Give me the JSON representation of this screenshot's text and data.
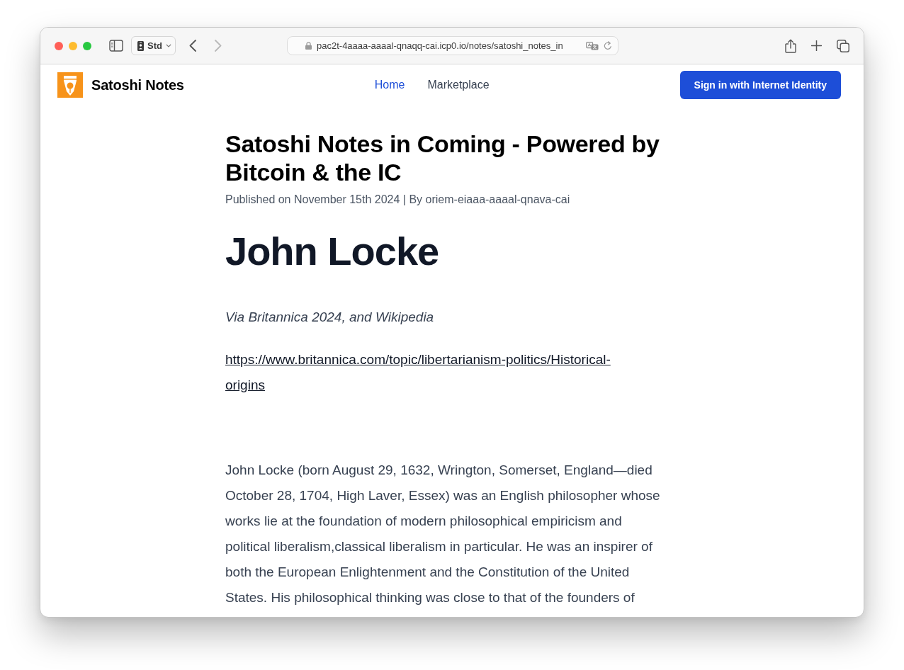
{
  "browser": {
    "profile_label": "Std",
    "navigation": [
      {
        "kind": "back",
        "disabled": false
      },
      {
        "kind": "forward",
        "disabled": true
      }
    ],
    "address": "pac2t-4aaaa-aaaal-qnaqq-cai.icp0.io/notes/satoshi_notes_in"
  },
  "site_header": {
    "site_name": "Satoshi Notes",
    "nav": [
      {
        "label": "Home",
        "selected": true
      },
      {
        "label": "Marketplace",
        "selected": false
      }
    ],
    "sign_in_button": "Sign in with Internet Identity"
  },
  "article": {
    "title": "Satoshi Notes in Coming - Powered by Bitcoin & the IC",
    "byline": "Published on November 15th 2024 | By oriem-eiaaa-aaaal-qnava-cai",
    "heading": "John Locke",
    "source_note": "Via Britannica 2024, and Wikipedia",
    "link": "https://www.britannica.com/topic/libertarianism-politics/Historical-origins",
    "paragraph": "John Locke (born August 29, 1632, Wrington, Somerset, England—died October 28, 1704, High Laver, Essex) was an English philosopher whose works lie at the foundation of modern philosophical empiricism and political liberalism,classical liberalism in particular. He was an inspirer of both the European Enlightenment and the Constitution of the United States. His philosophical thinking was close to that of the founders of"
  }
}
